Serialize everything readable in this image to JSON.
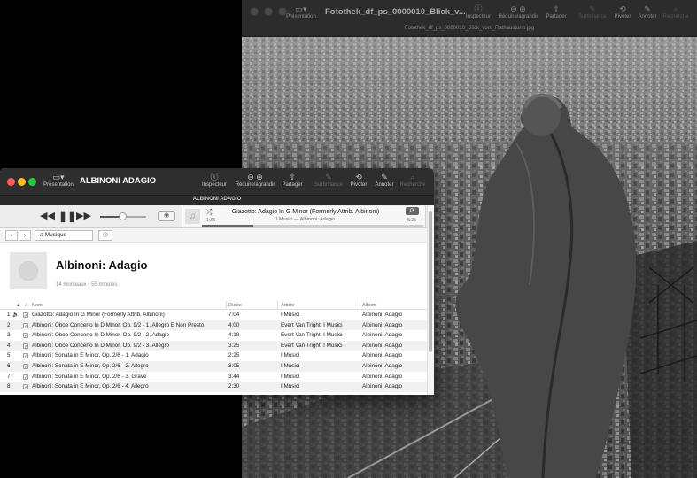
{
  "photo_window": {
    "title": "Fotothek_df_ps_0000010_Blick_v...",
    "subtitle": "Fotothek_df_ps_0000010_Blick_vom_Rathausturm.jpg",
    "toolbar": {
      "presentation": "Présentation",
      "inspector": "Inspecteur",
      "zoom": "Réduire/agrandir",
      "share": "Partager",
      "highlight": "Surbrillance",
      "rotate": "Pivoter",
      "annotate": "Annoter",
      "search": "Recherche"
    }
  },
  "itunes": {
    "title": "ALBINONI ADAGIO",
    "tab_label": "ALBINONI ADAGIO",
    "toolbar": {
      "presentation": "Présentation",
      "inspector": "Inspecteur",
      "zoom": "Réduire/agrandir",
      "share": "Partager",
      "highlight": "Surbrillance",
      "rotate": "Pivoter",
      "annotate": "Annoter",
      "search": "Recherche"
    },
    "now_playing": {
      "title": "Giazotto: Adagio In G Minor (Formerly Attrib. Albinoni)",
      "subtitle": "I Musici — Albinoni: Adagio",
      "elapsed": "1:38",
      "remaining": "-5:25",
      "progress": 0.23,
      "volume": 0.48
    },
    "media_selector": "Musique",
    "album": {
      "title": "Albinoni: Adagio",
      "meta": "14 morceaux • 55 minutes"
    },
    "columns": {
      "name": "Nom",
      "duration": "Durée",
      "artist": "Artiste",
      "album": "Album"
    },
    "tracks": [
      {
        "n": "1",
        "name": "Giazotto: Adagio In G Minor (Formerly Attrib. Albinoni)",
        "duration": "7:04",
        "artist": "I Musici",
        "album": "Albinoni: Adagio"
      },
      {
        "n": "2",
        "name": "Albinoni: Oboe Concerto In D Minor, Op. 9/2 - 1. Allegro E Non Presto",
        "duration": "4:00",
        "artist": "Evert Van Tright: I Musici",
        "album": "Albinoni: Adagio"
      },
      {
        "n": "3",
        "name": "Albinoni: Oboe Concerto In D Minor, Op. 9/2 - 2. Adagio",
        "duration": "4:18",
        "artist": "Evert Van Tright: I Musici",
        "album": "Albinoni: Adagio"
      },
      {
        "n": "4",
        "name": "Albinoni: Oboe Concerto In D Minor, Op. 9/2 - 3. Allegro",
        "duration": "3:25",
        "artist": "Evert Van Tright: I Musici",
        "album": "Albinoni: Adagio"
      },
      {
        "n": "5",
        "name": "Albinoni: Sonata in E Minor, Op. 2/6 - 1. Adagio",
        "duration": "2:25",
        "artist": "I Musici",
        "album": "Albinoni: Adagio"
      },
      {
        "n": "6",
        "name": "Albinoni: Sonata in E Minor, Op. 2/6 - 2. Allegro",
        "duration": "3:05",
        "artist": "I Musici",
        "album": "Albinoni: Adagio"
      },
      {
        "n": "7",
        "name": "Albinoni: Sonata in E Minor, Op. 2/6 - 3. Grave",
        "duration": "3:44",
        "artist": "I Musici",
        "album": "Albinoni: Adagio"
      },
      {
        "n": "8",
        "name": "Albinoni: Sonata in E Minor, Op. 2/6 - 4. Allegro",
        "duration": "2:30",
        "artist": "I Musici",
        "album": "Albinoni: Adagio"
      }
    ]
  },
  "colors": {
    "close": "#fc5f57",
    "minimize": "#fdbc2e",
    "zoom": "#28c840",
    "speaker_accent": "#1a73e8"
  }
}
